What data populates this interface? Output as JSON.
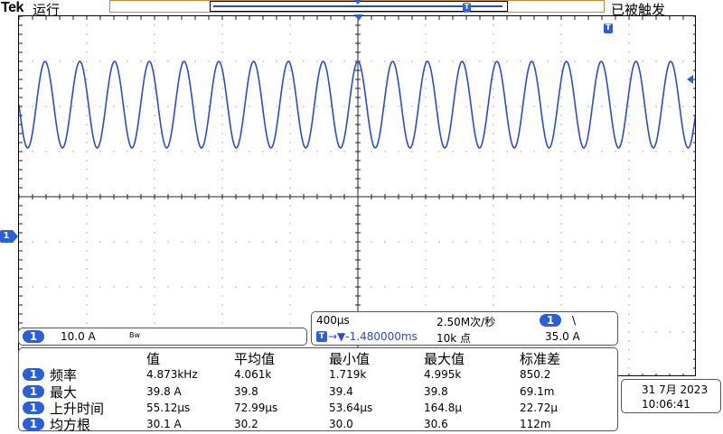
{
  "header": {
    "brand": "Tek",
    "run_state": "运行",
    "trigger_status": "已被触发",
    "trigger_marker": "T"
  },
  "channel": {
    "badge": "1",
    "scale": "10.0 A",
    "bw_label": "Bw",
    "ground_marker": "1"
  },
  "timebase": {
    "per_div": "400μs",
    "sample_rate": "2.50M次/秒",
    "trigger_badge": "T",
    "position": "→▼-1.480000ms",
    "record_length": "10k 点",
    "trigger_source_badge": "1",
    "trigger_slope": "\\",
    "trigger_level": "35.0 A"
  },
  "measurements": {
    "headers": [
      "值",
      "平均值",
      "最小值",
      "最大值",
      "标准差"
    ],
    "rows": [
      {
        "badge": "1",
        "label": "频率",
        "values": [
          "4.873kHz",
          "4.061k",
          "1.719k",
          "4.995k",
          "850.2"
        ]
      },
      {
        "badge": "1",
        "label": "最大",
        "values": [
          "39.8 A",
          "39.8",
          "39.4",
          "39.8",
          "69.1m"
        ]
      },
      {
        "badge": "1",
        "label": "上升时间",
        "values": [
          "55.12μs",
          "72.99μs",
          "53.64μs",
          "164.8μ",
          "22.72μ"
        ]
      },
      {
        "badge": "1",
        "label": "均方根",
        "values": [
          "30.1 A",
          "30.2",
          "30.0",
          "30.6",
          "112m"
        ]
      }
    ]
  },
  "datetime": {
    "date": "31 7月 2023",
    "time": "10:06:41"
  },
  "waveform": {
    "color": "#2b4bd6",
    "cycles_visible": 19.5
  }
}
